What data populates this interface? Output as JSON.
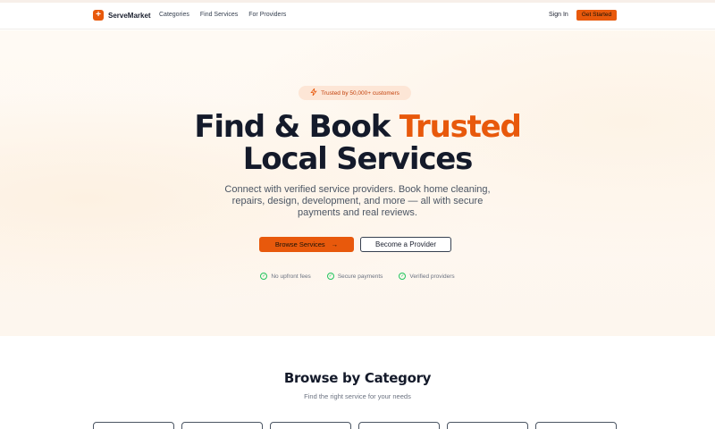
{
  "nav": {
    "brand": "ServeMarket",
    "logo_glyph": "+",
    "links": [
      "Categories",
      "Find Services",
      "For Providers"
    ],
    "signin": "Sign In",
    "get_started": "Get Started"
  },
  "hero": {
    "badge_icon": "lightning-icon",
    "badge_text": "Trusted by 50,000+ customers",
    "headline_part1": "Find & Book ",
    "headline_accent": "Trusted",
    "headline_line2": "Local Services",
    "subtext": "Connect with verified service providers. Book home cleaning, repairs, design, development, and more — all with secure payments and real reviews.",
    "primary_button": "Browse Services",
    "primary_arrow": "→",
    "secondary_button": "Become a Provider",
    "trust": [
      "No upfront fees",
      "Secure payments",
      "Verified providers"
    ]
  },
  "categories": {
    "title": "Browse by Category",
    "subtitle": "Find the right service for your needs",
    "card_count": 6
  },
  "colors": {
    "accent": "#e8590c",
    "text": "#141a2a",
    "muted": "#6b7280",
    "check": "#22c55e"
  }
}
